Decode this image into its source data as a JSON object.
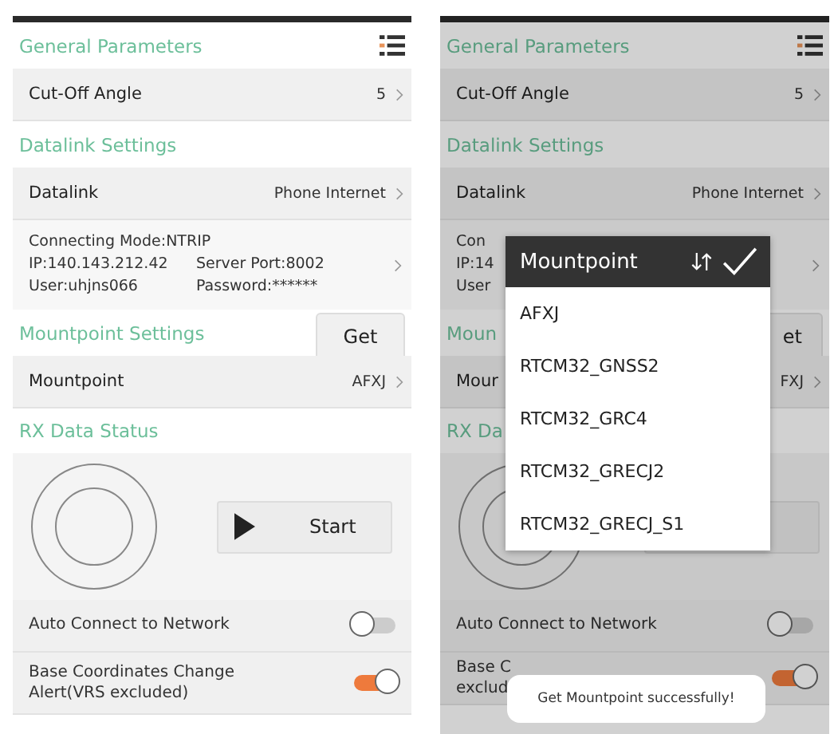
{
  "screens": [
    {
      "items": [
        {
          "kind": "title",
          "title": "General Parameters"
        },
        {
          "kind": "row",
          "label": "Cut-Off Angle",
          "value": "5"
        },
        {
          "kind": "header",
          "title": "Datalink Settings"
        },
        {
          "kind": "row",
          "label": "Datalink",
          "value": "Phone Internet"
        },
        {
          "kind": "info",
          "lines": [
            [
              "Connecting Mode:NTRIP"
            ],
            [
              "IP:140.143.212.42",
              "Server Port:8002"
            ],
            [
              "User:uhjns066",
              "Password:******"
            ]
          ]
        },
        {
          "kind": "header",
          "title": "Mountpoint Settings",
          "button": "Get"
        },
        {
          "kind": "row",
          "label": "Mountpoint",
          "value": "AFXJ"
        },
        {
          "kind": "header",
          "title": "RX Data Status"
        },
        {
          "kind": "rx",
          "button": "Start"
        },
        {
          "kind": "toggle",
          "label": "Auto Connect to Network",
          "on": false
        },
        {
          "kind": "toggle",
          "label": "Base Coordinates Change Alert(VRS excluded)",
          "on": true
        }
      ]
    },
    {
      "items": [
        {
          "kind": "title",
          "title": "General Parameters"
        },
        {
          "kind": "row",
          "label": "Cut-Off Angle",
          "value": "5"
        },
        {
          "kind": "header",
          "title": "Datalink Settings"
        },
        {
          "kind": "row",
          "label": "Datalink",
          "value": "Phone Internet"
        },
        {
          "kind": "info",
          "lines": [
            [
              "Con"
            ],
            [
              "IP:14"
            ],
            [
              "User"
            ]
          ]
        },
        {
          "kind": "header",
          "title": "Moun",
          "button": "et"
        },
        {
          "kind": "row",
          "label": "Mour",
          "value": "FXJ"
        },
        {
          "kind": "header",
          "title": "RX Da"
        },
        {
          "kind": "rx"
        },
        {
          "kind": "toggle",
          "label": "Auto Connect to Network",
          "on": false
        },
        {
          "kind": "toggle",
          "label": "Base C\nexclud",
          "on": true
        }
      ],
      "popup": {
        "title": "Mountpoint",
        "options": [
          "AFXJ",
          "RTCM32_GNSS2",
          "RTCM32_GRC4",
          "RTCM32_GRECJ2",
          "RTCM32_GRECJ_S1"
        ]
      },
      "toast": "Get Mountpoint successfully!"
    }
  ]
}
